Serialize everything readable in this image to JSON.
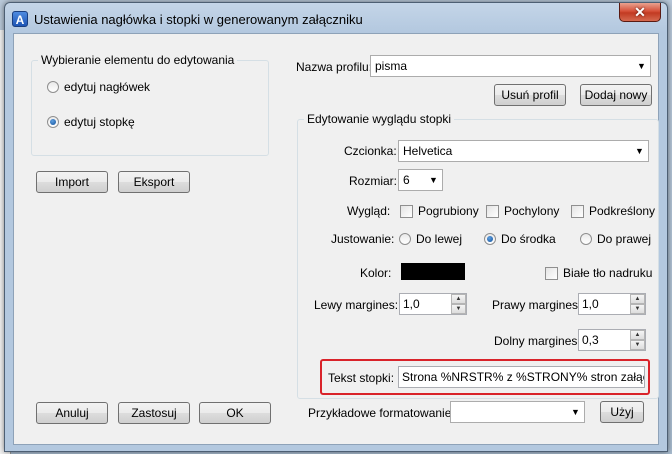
{
  "window": {
    "title": "Ustawienia nagłówka i stopki w generowanym załączniku",
    "app_icon": "A",
    "close_glyph": "✕"
  },
  "element_group": {
    "title": "Wybieranie elementu do edytowania",
    "options": [
      {
        "label": "edytuj nagłówek",
        "checked": false
      },
      {
        "label": "edytuj stopkę",
        "checked": true
      }
    ]
  },
  "buttons": {
    "import": "Import",
    "export": "Eksport",
    "cancel": "Anuluj",
    "apply": "Zastosuj",
    "ok": "OK",
    "delete_profile": "Usuń profil",
    "add_new": "Dodaj nowy",
    "use": "Użyj"
  },
  "profile": {
    "label": "Nazwa profilu:",
    "value": "pisma"
  },
  "footer_group": {
    "title": "Edytowanie wyglądu stopki",
    "font": {
      "label": "Czcionka:",
      "value": "Helvetica"
    },
    "size": {
      "label": "Rozmiar:",
      "value": "6"
    },
    "style": {
      "label": "Wygląd:",
      "options": [
        {
          "label": "Pogrubiony",
          "checked": false
        },
        {
          "label": "Pochylony",
          "checked": false
        },
        {
          "label": "Podkreślony",
          "checked": false
        }
      ]
    },
    "align": {
      "label": "Justowanie:",
      "options": [
        {
          "label": "Do lewej",
          "checked": false
        },
        {
          "label": "Do środka",
          "checked": true
        },
        {
          "label": "Do prawej",
          "checked": false
        }
      ]
    },
    "color": {
      "label": "Kolor:",
      "value": "#000000"
    },
    "white_bg": {
      "label": "Białe tło nadruku",
      "checked": false
    },
    "left_margin": {
      "label": "Lewy margines:",
      "value": "1,0"
    },
    "right_margin": {
      "label": "Prawy margines:",
      "value": "1,0"
    },
    "bottom_margin": {
      "label": "Dolny margines:",
      "value": "0,3"
    },
    "footer_text": {
      "label": "Tekst stopki:",
      "value": "Strona %NRSTR% z %STRONY% stron załącznika"
    }
  },
  "sample_format": {
    "label": "Przykładowe formatowanie:",
    "value": ""
  },
  "icons": {
    "combo_arrow": "▼",
    "spin_up": "▲",
    "spin_down": "▼"
  },
  "colors": {
    "highlight": "#d9232a",
    "close_button": "#c23a22"
  }
}
